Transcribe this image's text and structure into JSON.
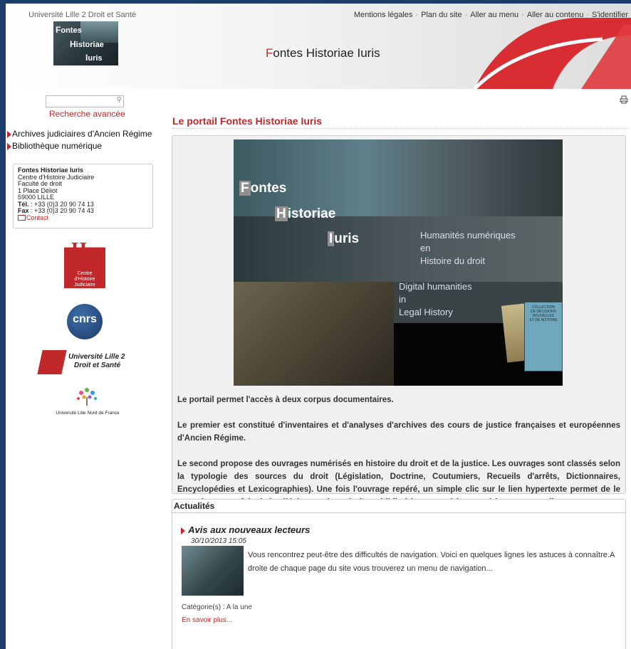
{
  "header": {
    "university_link": "Université Lille 2 Droit et Santé",
    "site_title_first": "F",
    "site_title_rest": "ontes Historiae Iuris",
    "logo_words": [
      "F",
      "ontes",
      "H",
      "istoriae",
      "I",
      "uris"
    ],
    "top_nav": [
      "Mentions légales",
      "Plan du site",
      "Aller au menu",
      "Aller au contenu",
      "S'identifier"
    ],
    "top_nav_sep": "·"
  },
  "sidebar": {
    "search_placeholder": "",
    "advanced_search": "Recherche avancée",
    "menu": [
      "Archives judiciaires d'Ancien Régime",
      "Bibliothèque numérique"
    ],
    "contact": {
      "title": "Fontes Historiae Iuris",
      "lines": [
        "Centre d'Histoire Judiciaire",
        "Faculté de droit",
        "1 Place Déliot",
        "59000 LILLE"
      ],
      "tel_label": "Tél.",
      "tel": " : +33 (0)3 20 90 74 13",
      "fax_label": "Fax",
      "fax": " : +33 (0)3 20 90 74 43",
      "contact_link": "Contact"
    },
    "logos": {
      "chj": [
        "Centre",
        "d'Histoire",
        "Judiciaire"
      ],
      "cnrs": "cnrs",
      "lille2": [
        "Université Lille 2",
        "Droit et Santé"
      ],
      "lnf": "Université Lille Nord de France"
    }
  },
  "main": {
    "portal_title": "Le portail Fontes Historiae Iuris",
    "banner": {
      "w1_cap": "F",
      "w1": "ontes",
      "w2_cap": "H",
      "w2": "istoriae",
      "w3_cap": "I",
      "w3": "uris",
      "fr": [
        "Humanités numériques",
        "en",
        "Histoire du droit"
      ],
      "en": [
        "Digital humanities",
        "in",
        "Legal History"
      ],
      "book_label": [
        "COLLECTION",
        "DE DÉCISIONS",
        "NOUVELLES",
        "ET DE NOTIONS"
      ]
    },
    "paragraphs": [
      "Le portail permet l'accès à deux corpus documentaires.",
      "Le premier est constitué d'inventaires et d'analyses d'archives des cours de justice françaises et européennes d'Ancien Régime.",
      "Le second propose des ouvrages numérisés en histoire du droit et de la justice. Les ouvrages sont classés selon la typologie des sources du droit (Législation, Doctrine, Coutumiers, Recueils d'arrêts, Dictionnaires, Encyclopédies et Lexicographies). Une fois l'ouvrage repéré, un simple clic sur le lien hypertexte permet de le consulter, et parfois de le télécharger, à partir d'une bibliothèque numérique extérieure au portail."
    ]
  },
  "news": {
    "header": "Actualités",
    "item": {
      "title": "Avis aux nouveaux lecteurs",
      "date": "30/10/2013 15:05",
      "text": "Vous rencontrez peut-être des difficultés de navigation. Voici en quelques lignes les astuces à connaître.A droite de chaque page du site vous trouverez un menu de navigation...",
      "category": "Catégorie(s) : A la une",
      "more": "En savoir plus..."
    }
  },
  "colors": {
    "accent": "#c0282c",
    "frame": "#1c3c6b"
  }
}
